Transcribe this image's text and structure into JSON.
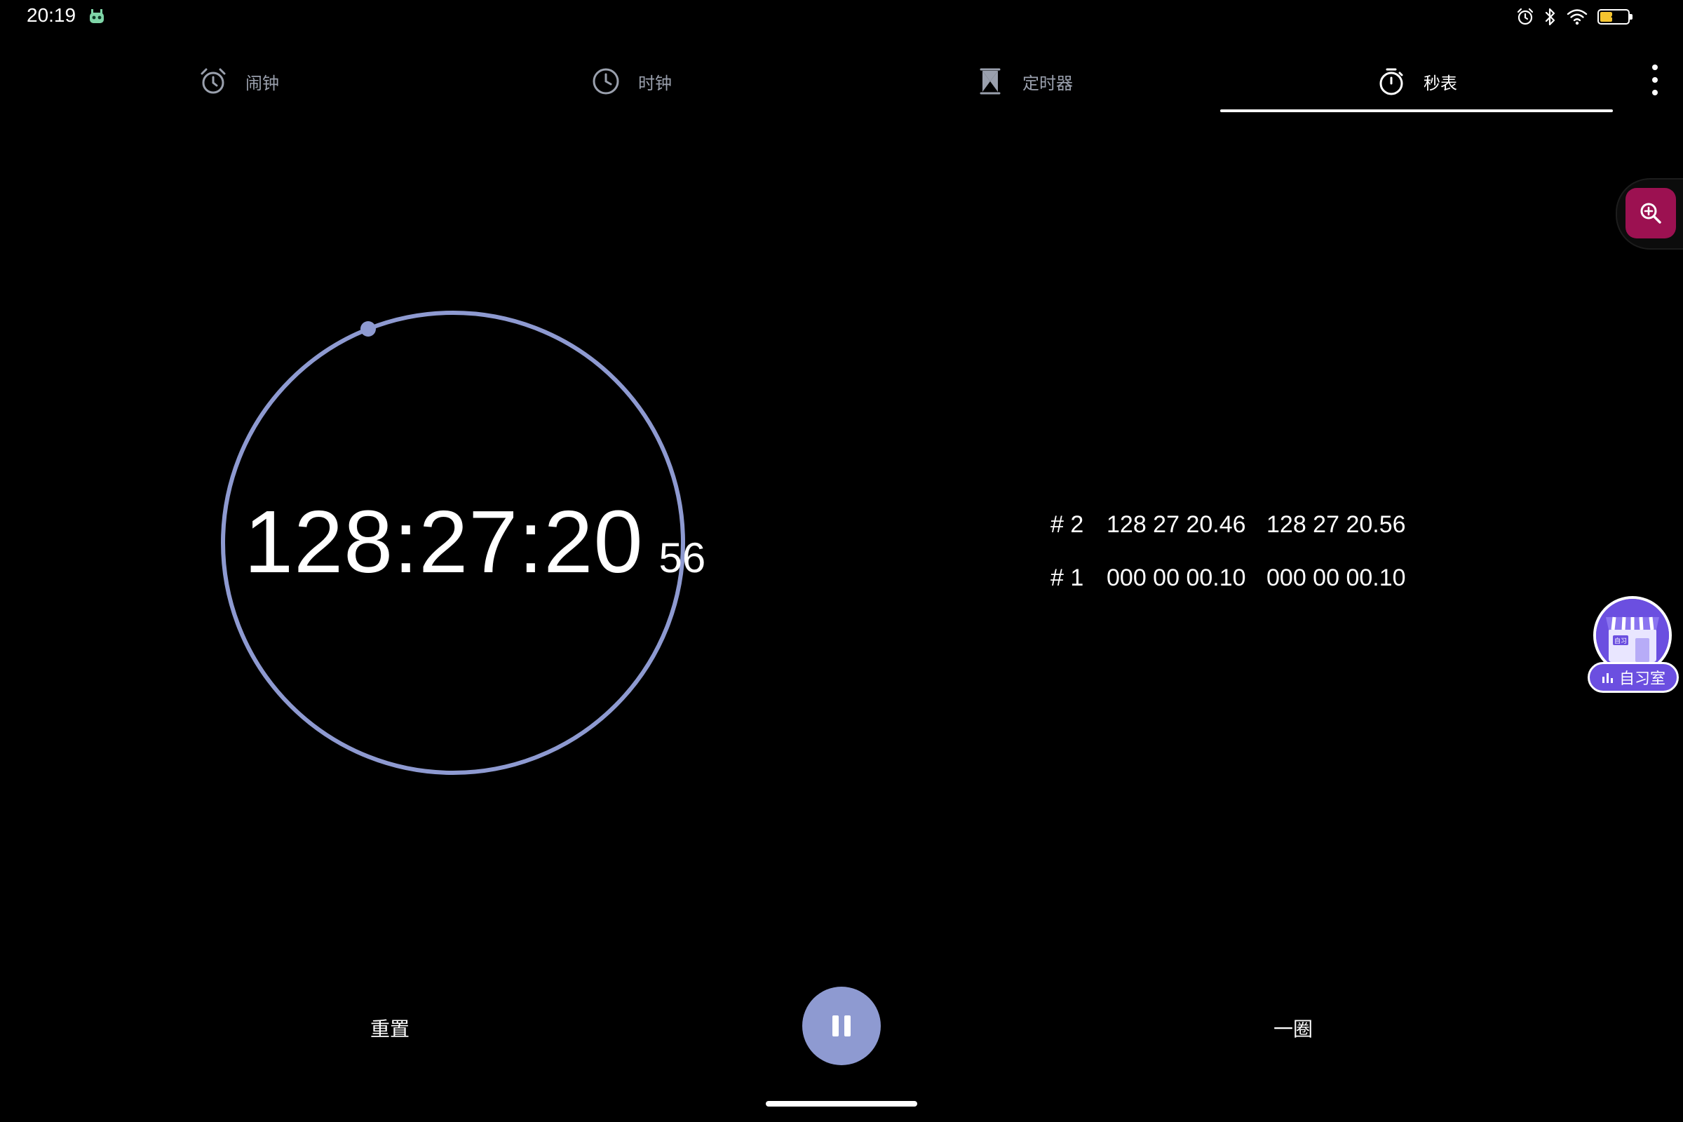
{
  "status_bar": {
    "time": "20:19",
    "app_icon": "robot-icon",
    "icons": [
      "alarm-icon",
      "bluetooth-icon",
      "wifi-icon"
    ],
    "battery_level": "2",
    "battery_color": "#f4c430"
  },
  "tabs": [
    {
      "label": "闹钟",
      "icon": "alarm-icon",
      "active": false
    },
    {
      "label": "时钟",
      "icon": "clock-icon",
      "active": false
    },
    {
      "label": "定时器",
      "icon": "hourglass-icon",
      "active": false
    },
    {
      "label": "秒表",
      "icon": "stopwatch-icon",
      "active": true
    }
  ],
  "menu_icon": "more-vertical-icon",
  "magnifier": {
    "icon": "zoom-in-icon",
    "color": "#9c1151"
  },
  "stopwatch": {
    "elapsed": "128:27:20",
    "hundredths": "56",
    "dial_color": "#8e9ad1"
  },
  "laps": [
    {
      "index": "# 2",
      "lap_time": "128 27 20.46",
      "total_time": "128 27 20.56"
    },
    {
      "index": "# 1",
      "lap_time": "000 00 00.10",
      "total_time": "000 00 00.10"
    }
  ],
  "controls": {
    "reset_label": "重置",
    "pause_icon": "pause-icon",
    "lap_label": "一圈",
    "accent_color": "#8e9ad1"
  },
  "study_room": {
    "label": "自习室",
    "badge_text": "自习",
    "icon": "store-icon",
    "color": "#6b4fe0"
  }
}
